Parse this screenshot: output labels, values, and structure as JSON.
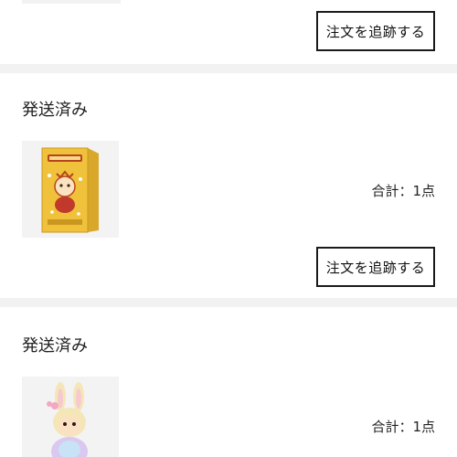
{
  "orders": [
    {
      "track_label": "注文を追跡する"
    },
    {
      "status": "発送済み",
      "total": "合計：1点",
      "track_label": "注文を追跡する",
      "product_icon": "boxed-figure-product-image"
    },
    {
      "status": "発送済み",
      "total": "合計：1点",
      "product_icon": "bunny-figure-product-image"
    }
  ],
  "colors": {
    "separator": "#f2f2f2",
    "button_border": "#1a1a1a",
    "text": "#222222"
  }
}
